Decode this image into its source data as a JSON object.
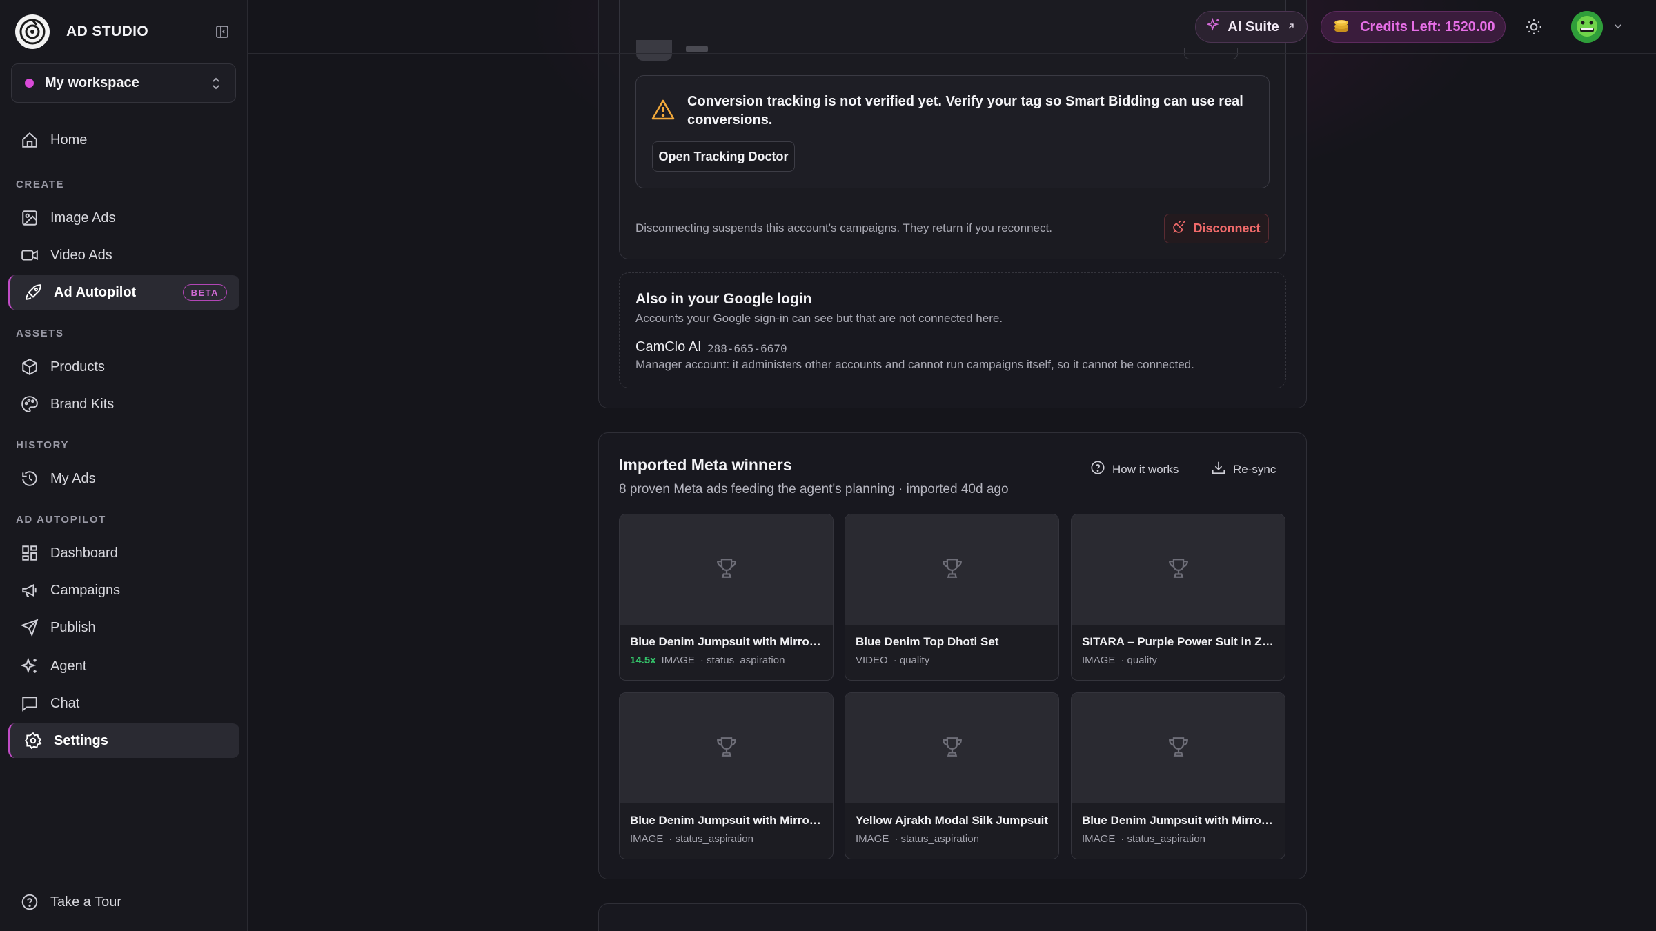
{
  "brand": {
    "name": "AD STUDIO"
  },
  "workspace": {
    "label": "My workspace",
    "dot_color": "#d94ad8"
  },
  "nav": {
    "home": "Home",
    "sections": {
      "create": "CREATE",
      "assets": "ASSETS",
      "history": "HISTORY",
      "autopilot": "AD AUTOPILOT"
    },
    "image_ads": "Image Ads",
    "video_ads": "Video Ads",
    "ad_autopilot": "Ad Autopilot",
    "beta_badge": "BETA",
    "products": "Products",
    "brand_kits": "Brand Kits",
    "my_ads": "My Ads",
    "dashboard": "Dashboard",
    "campaigns": "Campaigns",
    "publish": "Publish",
    "agent": "Agent",
    "chat": "Chat",
    "settings": "Settings",
    "take_tour": "Take a Tour"
  },
  "header": {
    "ai_suite": "AI Suite",
    "credits": "Credits Left: 1520.00",
    "accent_color": "#e66ee6"
  },
  "connection": {
    "alert_text": "Conversion tracking is not verified yet. Verify your tag so Smart Bidding can use real conversions.",
    "open_tracking_doctor": "Open Tracking Doctor",
    "disconnect_note": "Disconnecting suspends this account's campaigns. They return if you reconnect.",
    "disconnect_label": "Disconnect",
    "warning_color": "#f2a93b",
    "danger_color": "#f06a6a"
  },
  "also": {
    "title": "Also in your Google login",
    "subtitle": "Accounts your Google sign-in can see but that are not connected here.",
    "account_name": "CamClo AI",
    "account_id": "288-665-6670",
    "account_note": "Manager account: it administers other accounts and cannot run campaigns itself, so it cannot be connected."
  },
  "winners": {
    "title": "Imported Meta winners",
    "subtitle": "8 proven Meta ads feeding the agent's planning · imported 40d ago",
    "how_it_works": "How it works",
    "resync": "Re-sync",
    "cards": [
      {
        "title": "Blue Denim Jumpsuit with Mirror ...",
        "metric": "14.5x",
        "type": "IMAGE",
        "tag": "· status_aspiration"
      },
      {
        "title": "Blue Denim Top Dhoti Set",
        "metric": "",
        "type": "VIDEO",
        "tag": "· quality"
      },
      {
        "title": "SITARA – Purple Power Suit in Zar...",
        "metric": "",
        "type": "IMAGE",
        "tag": "· quality"
      },
      {
        "title": "Blue Denim Jumpsuit with Mirror ...",
        "metric": "",
        "type": "IMAGE",
        "tag": "· status_aspiration"
      },
      {
        "title": "Yellow Ajrakh Modal Silk Jumpsuit",
        "metric": "",
        "type": "IMAGE",
        "tag": "· status_aspiration"
      },
      {
        "title": "Blue Denim Jumpsuit with Mirror ...",
        "metric": "",
        "type": "IMAGE",
        "tag": "· status_aspiration"
      }
    ]
  }
}
